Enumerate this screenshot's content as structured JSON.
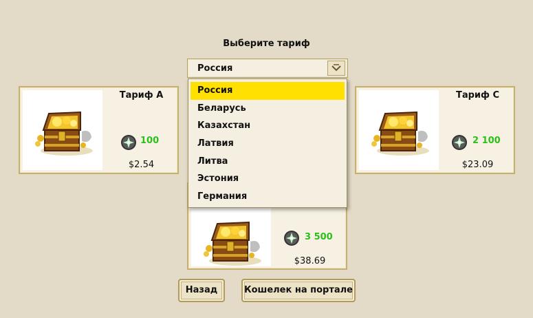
{
  "header": {
    "title": "Выберите тариф"
  },
  "country_select": {
    "selected": "Россия",
    "options": [
      "Россия",
      "Беларусь",
      "Казахстан",
      "Латвия",
      "Литва",
      "Эстония",
      "Германия"
    ]
  },
  "tariffs": [
    {
      "name": "Тариф A",
      "amount": "100",
      "price": "$2.54",
      "image": "treasure-chest"
    },
    {
      "name": "Тариф C",
      "amount": "2 100",
      "price": "$23.09",
      "image": "treasure-chest"
    },
    {
      "name": "",
      "amount": "3 500",
      "price": "$38.69",
      "image": "treasure-chest"
    }
  ],
  "buttons": {
    "back": "Назад",
    "wallet": "Кошелек на портале"
  },
  "icons": {
    "currency": "gem-icon",
    "dropdown": "chevron-down-icon"
  },
  "colors": {
    "background": "#e3dac7",
    "highlight": "#ffe000",
    "amount": "#2cbf1c",
    "border": "#c5b070"
  }
}
